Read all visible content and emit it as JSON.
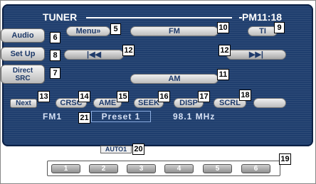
{
  "header": {
    "title": "TUNER",
    "clock": "PM11:18"
  },
  "top": {
    "menu_label": "Menu»",
    "band_label": "FM",
    "ti_label": "TI"
  },
  "side": {
    "audio": "Audio",
    "setup": "Set Up",
    "direct_line1": "Direct",
    "direct_line2": "SRC"
  },
  "seek": {
    "prev_icon": "|◀◀",
    "next_icon": "▶▶|"
  },
  "am_label": "AM",
  "function_bar": {
    "next": "Next",
    "crsc": "CRSC",
    "ame": "AME",
    "seek": "SEEK",
    "disp": "DISP",
    "scrl": "SCRL"
  },
  "status": {
    "band": "FM1",
    "preset": "Preset 1",
    "frequency": "98.1 MHz"
  },
  "auto_label": "AUTO1",
  "presets": [
    "1",
    "2",
    "3",
    "4",
    "5",
    "6"
  ],
  "callouts": {
    "c5": "5",
    "c6": "6",
    "c7": "7",
    "c8": "8",
    "c9": "9",
    "c10": "10",
    "c11": "11",
    "c12a": "12",
    "c12b": "12",
    "c13": "13",
    "c14": "14",
    "c15": "15",
    "c16": "16",
    "c17": "17",
    "c18": "18",
    "c19": "19",
    "c20": "20",
    "c21": "21"
  }
}
